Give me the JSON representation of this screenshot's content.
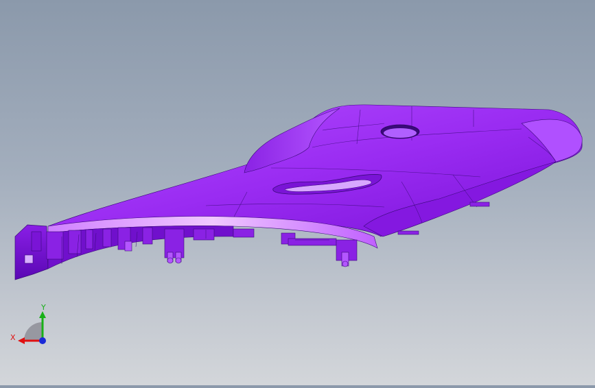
{
  "viewport": {
    "part_color": "#9b2ef0",
    "part_shadow": "#6a10c8",
    "part_highlight": "#c070ff",
    "edge_color": "#3a0a7a"
  },
  "triad": {
    "x_label": "X",
    "y_label": "Y",
    "x_color": "#e01010",
    "y_color": "#18b018",
    "z_color": "#1a2ad8"
  }
}
